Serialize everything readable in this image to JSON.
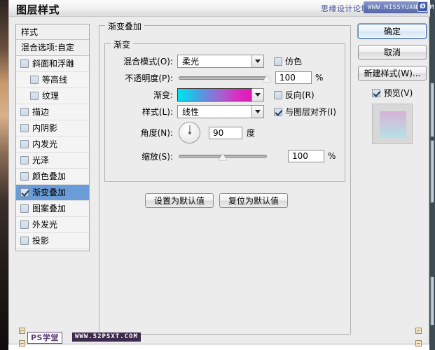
{
  "window": {
    "title": "图层样式"
  },
  "watermark_top": {
    "text": "思缘设计论坛",
    "url": "WWW.MISSYUAN.COM",
    "badge": "Ø"
  },
  "watermark_bottom": {
    "text": "PS学堂",
    "url": "WWW.52PSXT.COM"
  },
  "sidebar": {
    "header": "样式",
    "blending_options": "混合选项:自定",
    "items": [
      {
        "label": "斜面和浮雕",
        "checked": false,
        "indent": false,
        "selected": false
      },
      {
        "label": "等高线",
        "checked": false,
        "indent": true,
        "selected": false
      },
      {
        "label": "纹理",
        "checked": false,
        "indent": true,
        "selected": false
      },
      {
        "label": "描边",
        "checked": false,
        "indent": false,
        "selected": false
      },
      {
        "label": "内阴影",
        "checked": false,
        "indent": false,
        "selected": false
      },
      {
        "label": "内发光",
        "checked": false,
        "indent": false,
        "selected": false
      },
      {
        "label": "光泽",
        "checked": false,
        "indent": false,
        "selected": false
      },
      {
        "label": "颜色叠加",
        "checked": false,
        "indent": false,
        "selected": false
      },
      {
        "label": "渐变叠加",
        "checked": true,
        "indent": false,
        "selected": true
      },
      {
        "label": "图案叠加",
        "checked": false,
        "indent": false,
        "selected": false
      },
      {
        "label": "外发光",
        "checked": false,
        "indent": false,
        "selected": false
      },
      {
        "label": "投影",
        "checked": false,
        "indent": false,
        "selected": false
      }
    ]
  },
  "panel": {
    "group_outer_legend": "渐变叠加",
    "group_inner_legend": "渐变",
    "blend_mode": {
      "label": "混合模式(O):",
      "value": "柔光"
    },
    "dither": {
      "label": "仿色",
      "checked": false
    },
    "opacity": {
      "label": "不透明度(P):",
      "value": "100",
      "unit": "%",
      "percent": 100
    },
    "gradient": {
      "label": "渐变:",
      "stops": [
        "#00e5f0",
        "#2bb8e8",
        "#6f86dd",
        "#a85fd0",
        "#d92ec4",
        "#e018b8"
      ]
    },
    "reverse": {
      "label": "反向(R)",
      "checked": false
    },
    "style": {
      "label": "样式(L):",
      "value": "线性"
    },
    "align_with_layer": {
      "label": "与图层对齐(I)",
      "checked": true
    },
    "angle": {
      "label": "角度(N):",
      "value": "90",
      "unit": "度",
      "degrees": 90
    },
    "scale": {
      "label": "缩放(S):",
      "value": "100",
      "unit": "%",
      "percent": 50
    },
    "set_default_button": "设置为默认值",
    "reset_default_button": "复位为默认值"
  },
  "actions": {
    "ok": "确定",
    "cancel": "取消",
    "new_style": "新建样式(W)...",
    "preview": {
      "label": "预览(V)",
      "checked": true
    },
    "thumbnail_top_color": "#d7b2d8",
    "thumbnail_bottom_color": "#b6e1e6"
  }
}
